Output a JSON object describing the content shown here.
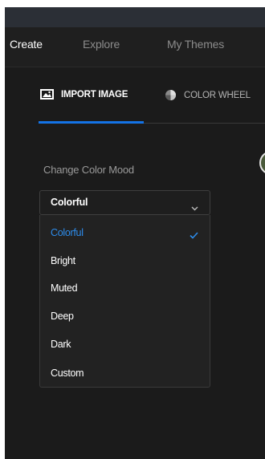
{
  "nav": {
    "items": [
      {
        "label": "Create",
        "active": true
      },
      {
        "label": "Explore",
        "active": false
      },
      {
        "label": "My Themes",
        "active": false
      }
    ]
  },
  "subtabs": [
    {
      "label": "IMPORT IMAGE",
      "icon": "image-icon",
      "active": true
    },
    {
      "label": "COLOR WHEEL",
      "icon": "color-wheel-icon",
      "active": false
    }
  ],
  "mood": {
    "label": "Change Color Mood",
    "selected": "Colorful",
    "options": [
      "Colorful",
      "Bright",
      "Muted",
      "Deep",
      "Dark",
      "Custom"
    ]
  },
  "colors": {
    "accent": "#1473e6",
    "selected_text": "#2d8ceb",
    "background": "#1b1b1b"
  }
}
